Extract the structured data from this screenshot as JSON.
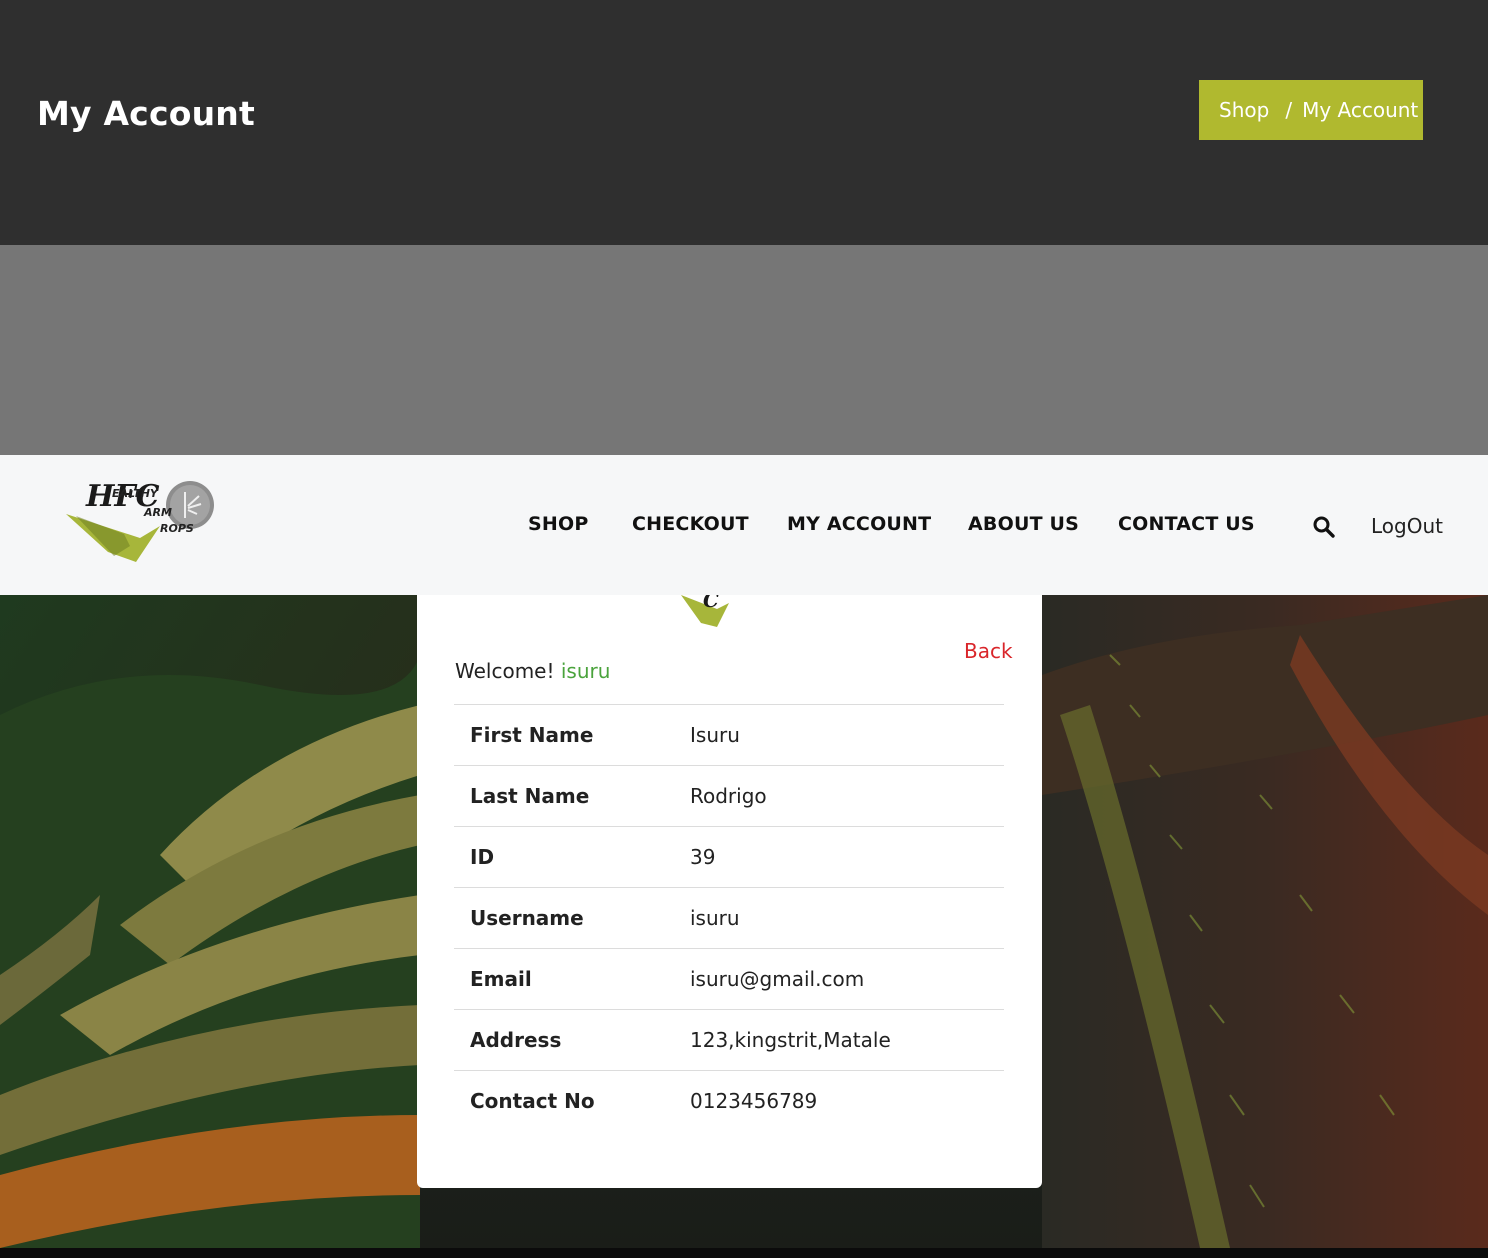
{
  "header": {
    "title": "My Account",
    "breadcrumb": {
      "shop": "Shop",
      "separator": "/",
      "current": "My Account"
    }
  },
  "nav": {
    "logo_text": {
      "line1": "EALTHY",
      "line2": "ARM",
      "line3": "ROPS",
      "letters": "HFC"
    },
    "items": [
      "SHOP",
      "CHECKOUT",
      "MY ACCOUNT",
      "ABOUT US",
      "CONTACT US"
    ],
    "search_icon": "search-icon",
    "logout": "LogOut"
  },
  "card": {
    "back": "Back",
    "welcome_prefix": "Welcome!",
    "welcome_user": "isuru",
    "rows": [
      {
        "label": "First Name",
        "value": "Isuru"
      },
      {
        "label": "Last Name",
        "value": "Rodrigo"
      },
      {
        "label": "ID",
        "value": "39"
      },
      {
        "label": "Username",
        "value": "isuru"
      },
      {
        "label": "Email",
        "value": "isuru@gmail.com"
      },
      {
        "label": "Address",
        "value": "123,kingstrit,Matale"
      },
      {
        "label": "Contact No",
        "value": "0123456789"
      }
    ]
  },
  "colors": {
    "header_bg": "#2f2f2f",
    "breadcrumb_bg": "#b0b92f",
    "grey_band": "#767676",
    "navbar_bg": "#f6f7f8",
    "back_link": "#d9252a",
    "username_accent": "#4aa33c"
  }
}
